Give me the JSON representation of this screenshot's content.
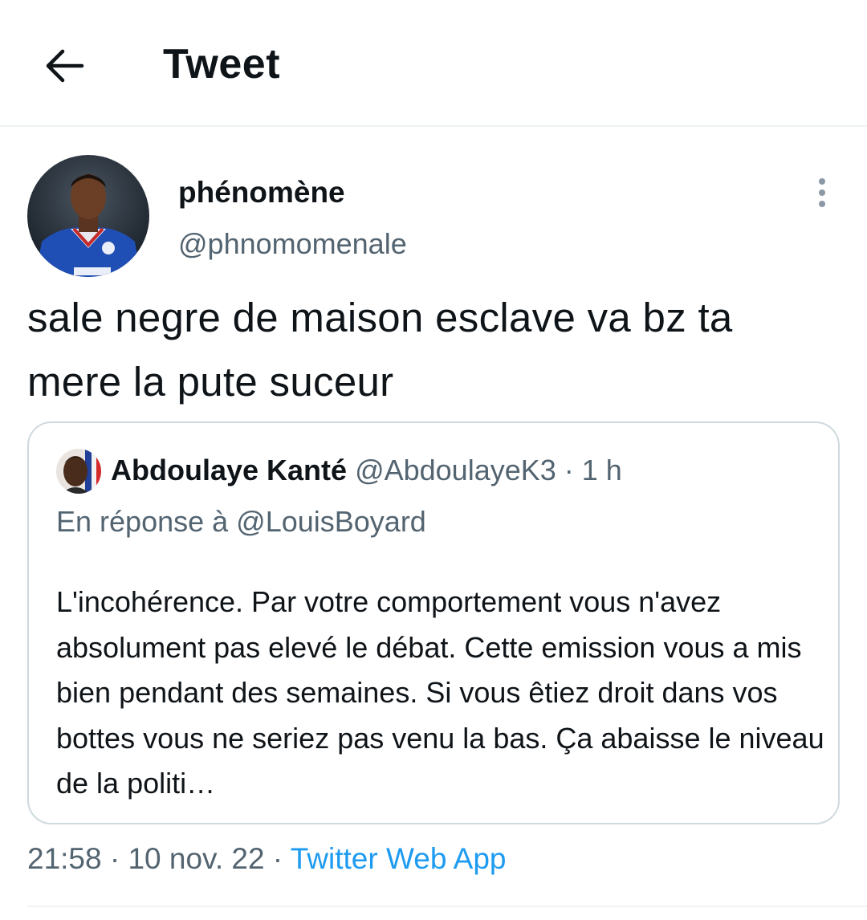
{
  "header": {
    "title": "Tweet",
    "back_icon": "arrow-left-icon"
  },
  "tweet": {
    "author_name": "phénomène",
    "author_handle": "@phnomomenale",
    "text": "sale negre de maison esclave va bz ta mere la pute suceur",
    "more_icon": "more-vertical-icon",
    "timestamp": "21:58 · 10 nov. 22",
    "separator": " · ",
    "source": "Twitter Web App"
  },
  "quoted_tweet": {
    "author_name": "Abdoulaye Kanté",
    "author_handle": "@AbdoulayeK3",
    "time_ago": " · 1 h",
    "reply_to": "En réponse à @LouisBoyard",
    "text": "L'incohérence. Par votre comportement vous n'avez absolument pas elevé le débat. Cette emission vous a mis bien pendant des semaines. Si vous êtiez droit dans vos bottes vous ne seriez pas venu la bas. Ça abaisse le niveau de la politi…"
  },
  "colors": {
    "text_primary": "#0f1419",
    "text_secondary": "#536471",
    "link": "#1d9bf0",
    "border": "#cfd9de"
  }
}
